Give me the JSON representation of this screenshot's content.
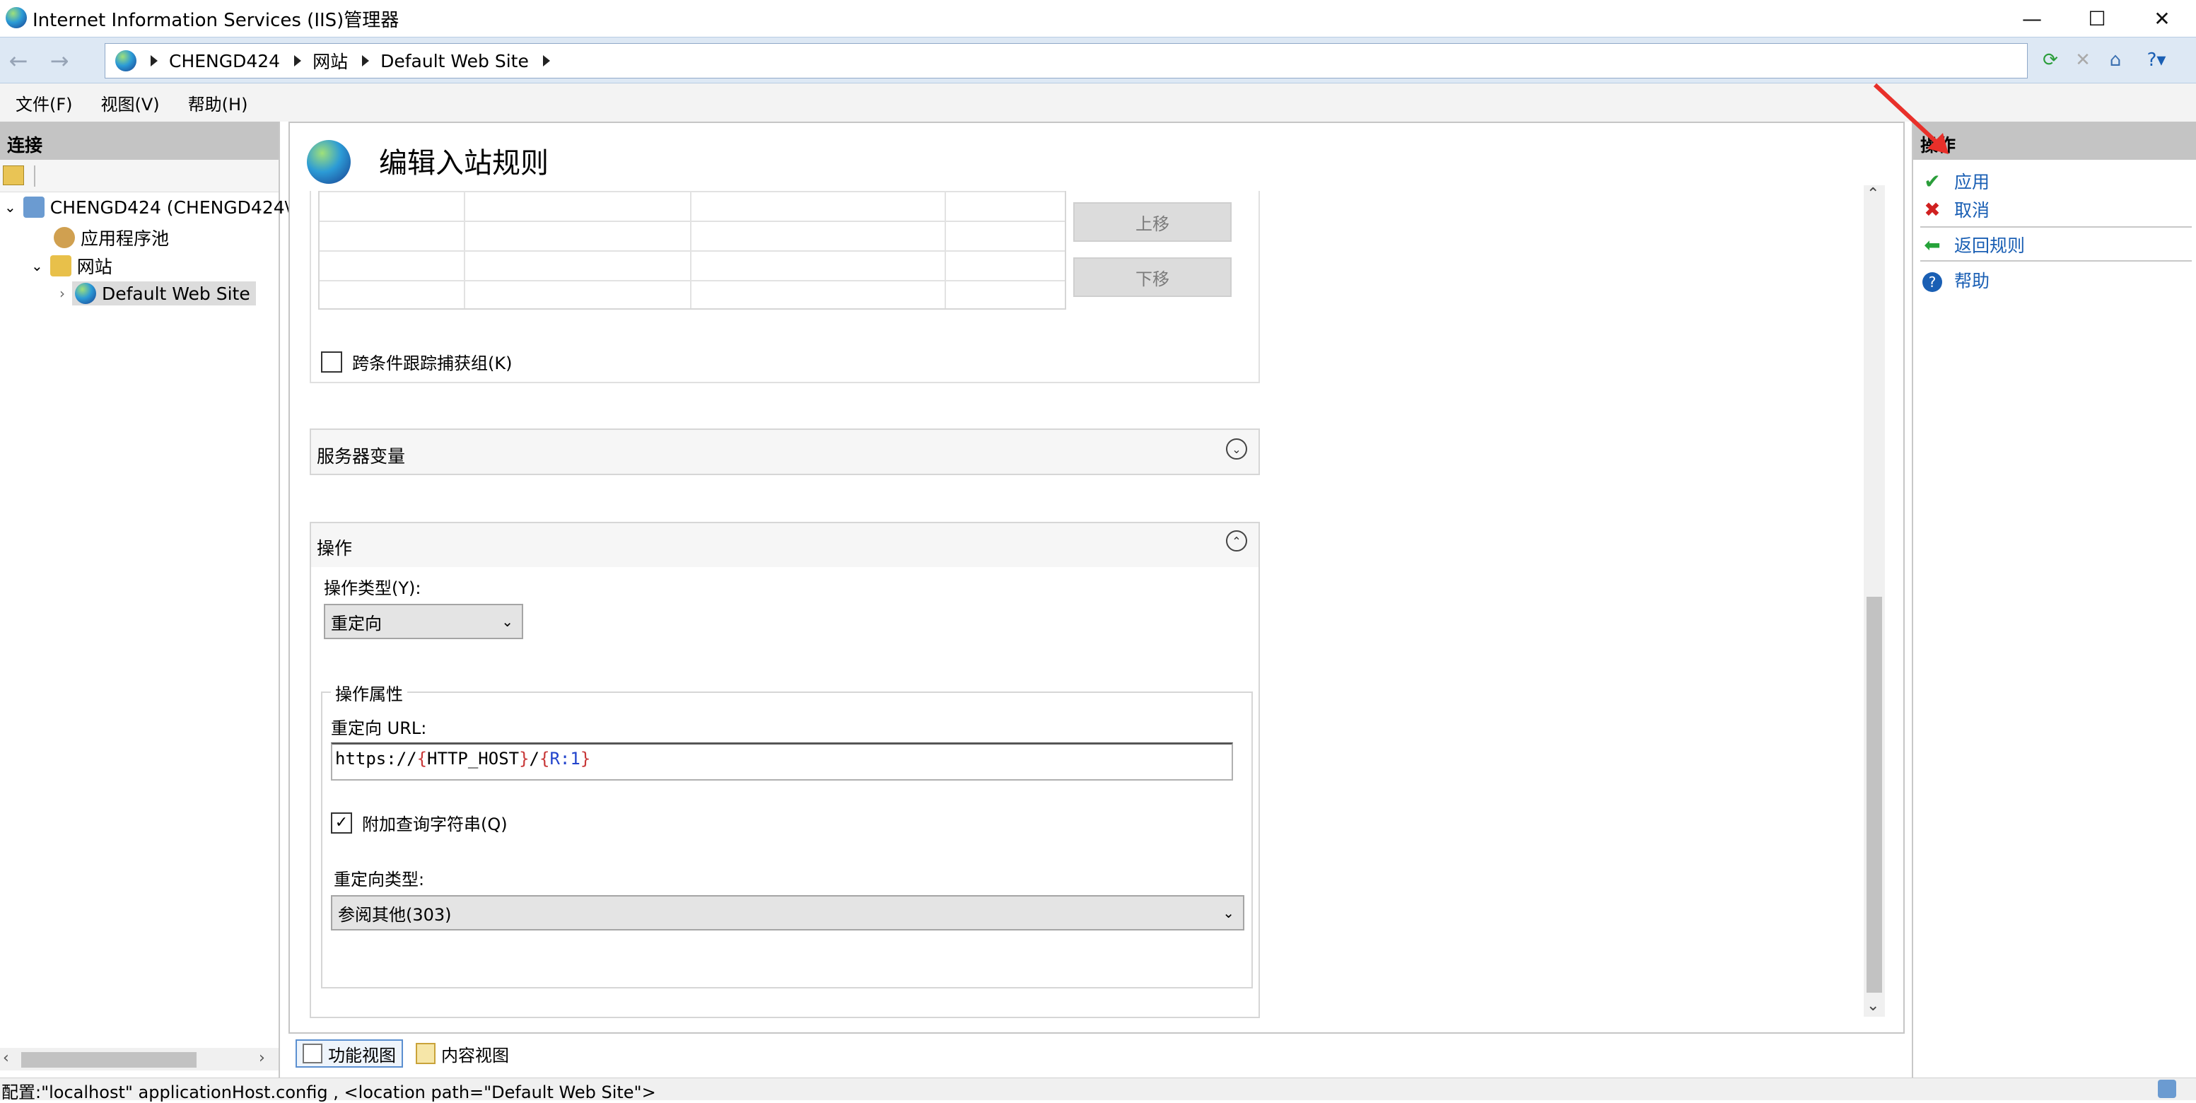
{
  "window": {
    "title": "Internet Information Services (IIS)管理器",
    "minimize": "—",
    "maximize": "☐",
    "close": "✕"
  },
  "address": {
    "segments": [
      "CHENGD424",
      "网站",
      "Default Web Site"
    ]
  },
  "menu": [
    "文件(F)",
    "视图(V)",
    "帮助(H)"
  ],
  "connections": {
    "header": "连接",
    "tree": [
      {
        "label": "CHENGD424 (CHENGD424\\",
        "level": 0,
        "expanded": true
      },
      {
        "label": "应用程序池",
        "level": 1
      },
      {
        "label": "网站",
        "level": 1,
        "expanded": true
      },
      {
        "label": "Default Web Site",
        "level": 2,
        "selected": true
      }
    ]
  },
  "main": {
    "title": "编辑入站规则",
    "move_up": "上移",
    "move_down": "下移",
    "track_capture": {
      "label": "跨条件跟踪捕获组(K)",
      "checked": false
    },
    "server_vars": {
      "title": "服务器变量",
      "expanded": false
    },
    "action": {
      "title": "操作",
      "expanded": true,
      "type_label": "操作类型(Y):",
      "type_value": "重定向",
      "props_legend": "操作属性",
      "url_label": "重定向 URL:",
      "url_parts": [
        "https://",
        "{",
        "HTTP_HOST",
        "}",
        "/",
        "{",
        "R:1",
        "}"
      ],
      "append_query": {
        "label": "附加查询字符串(Q)",
        "checked": true
      },
      "redirect_type_label": "重定向类型:",
      "redirect_type_value": "参阅其他(303)"
    },
    "tabs": {
      "feature_view": "功能视图",
      "content_view": "内容视图"
    }
  },
  "actions": {
    "header": "操作",
    "items": [
      {
        "label": "应用",
        "icon": "apply-icon"
      },
      {
        "label": "取消",
        "icon": "cancel-icon"
      },
      {
        "label": "返回规则",
        "icon": "back-arrow-icon"
      },
      {
        "label": "帮助",
        "icon": "help-icon"
      }
    ]
  },
  "status": {
    "text": "配置:\"localhost\" applicationHost.config , <location path=\"Default Web Site\">"
  },
  "colors": {
    "accent_link": "#1a5fb4",
    "header_gray": "#c4c4c4",
    "annotation_arrow": "#e8302a"
  }
}
